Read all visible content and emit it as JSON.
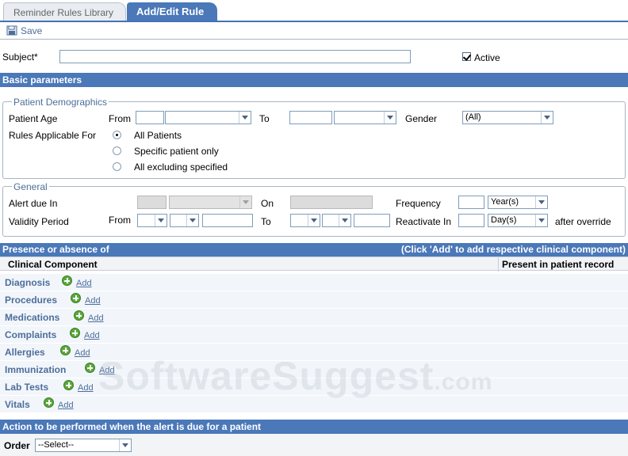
{
  "tabs": [
    {
      "label": "Reminder Rules Library",
      "active": false
    },
    {
      "label": "Add/Edit Rule",
      "active": true
    }
  ],
  "toolbar": {
    "save_label": "Save",
    "save_icon": "save-icon"
  },
  "subject": {
    "label": "Subject*",
    "value": "",
    "active_label": "Active",
    "active_checked": true
  },
  "basic_parameters": {
    "title": "Basic parameters"
  },
  "patient_demographics": {
    "legend": "Patient Demographics",
    "age_label": "Patient Age",
    "from_label": "From",
    "to_label": "To",
    "gender_label": "Gender",
    "gender_value": "(All)",
    "applicable_label": "Rules Applicable For",
    "options": [
      "All Patients",
      "Specific patient only",
      "All excluding specified"
    ],
    "selected_option": "All Patients"
  },
  "general": {
    "legend": "General",
    "alert_label": "Alert due In",
    "on_label": "On",
    "frequency_label": "Frequency",
    "frequency_unit": "Year(s)",
    "validity_label": "Validity Period",
    "from_label": "From",
    "to_label": "To",
    "reactivate_label": "Reactivate In",
    "reactivate_unit": "Day(s)",
    "after_override": "after override"
  },
  "presence": {
    "title": "Presence or absence of",
    "hint": "(Click 'Add' to add respective clinical component)",
    "col_component": "Clinical Component",
    "col_present": "Present in patient record",
    "add_label": "Add",
    "components": [
      "Diagnosis",
      "Procedures",
      "Medications",
      "Complaints",
      "Allergies",
      "Immunization",
      "Lab Tests",
      "Vitals"
    ]
  },
  "action": {
    "title": "Action to be performed when the alert is due for a patient",
    "order_label": "Order",
    "order_value": "--Select--"
  },
  "watermark": {
    "text": "SoftwareSuggest",
    "suffix": ".com"
  }
}
